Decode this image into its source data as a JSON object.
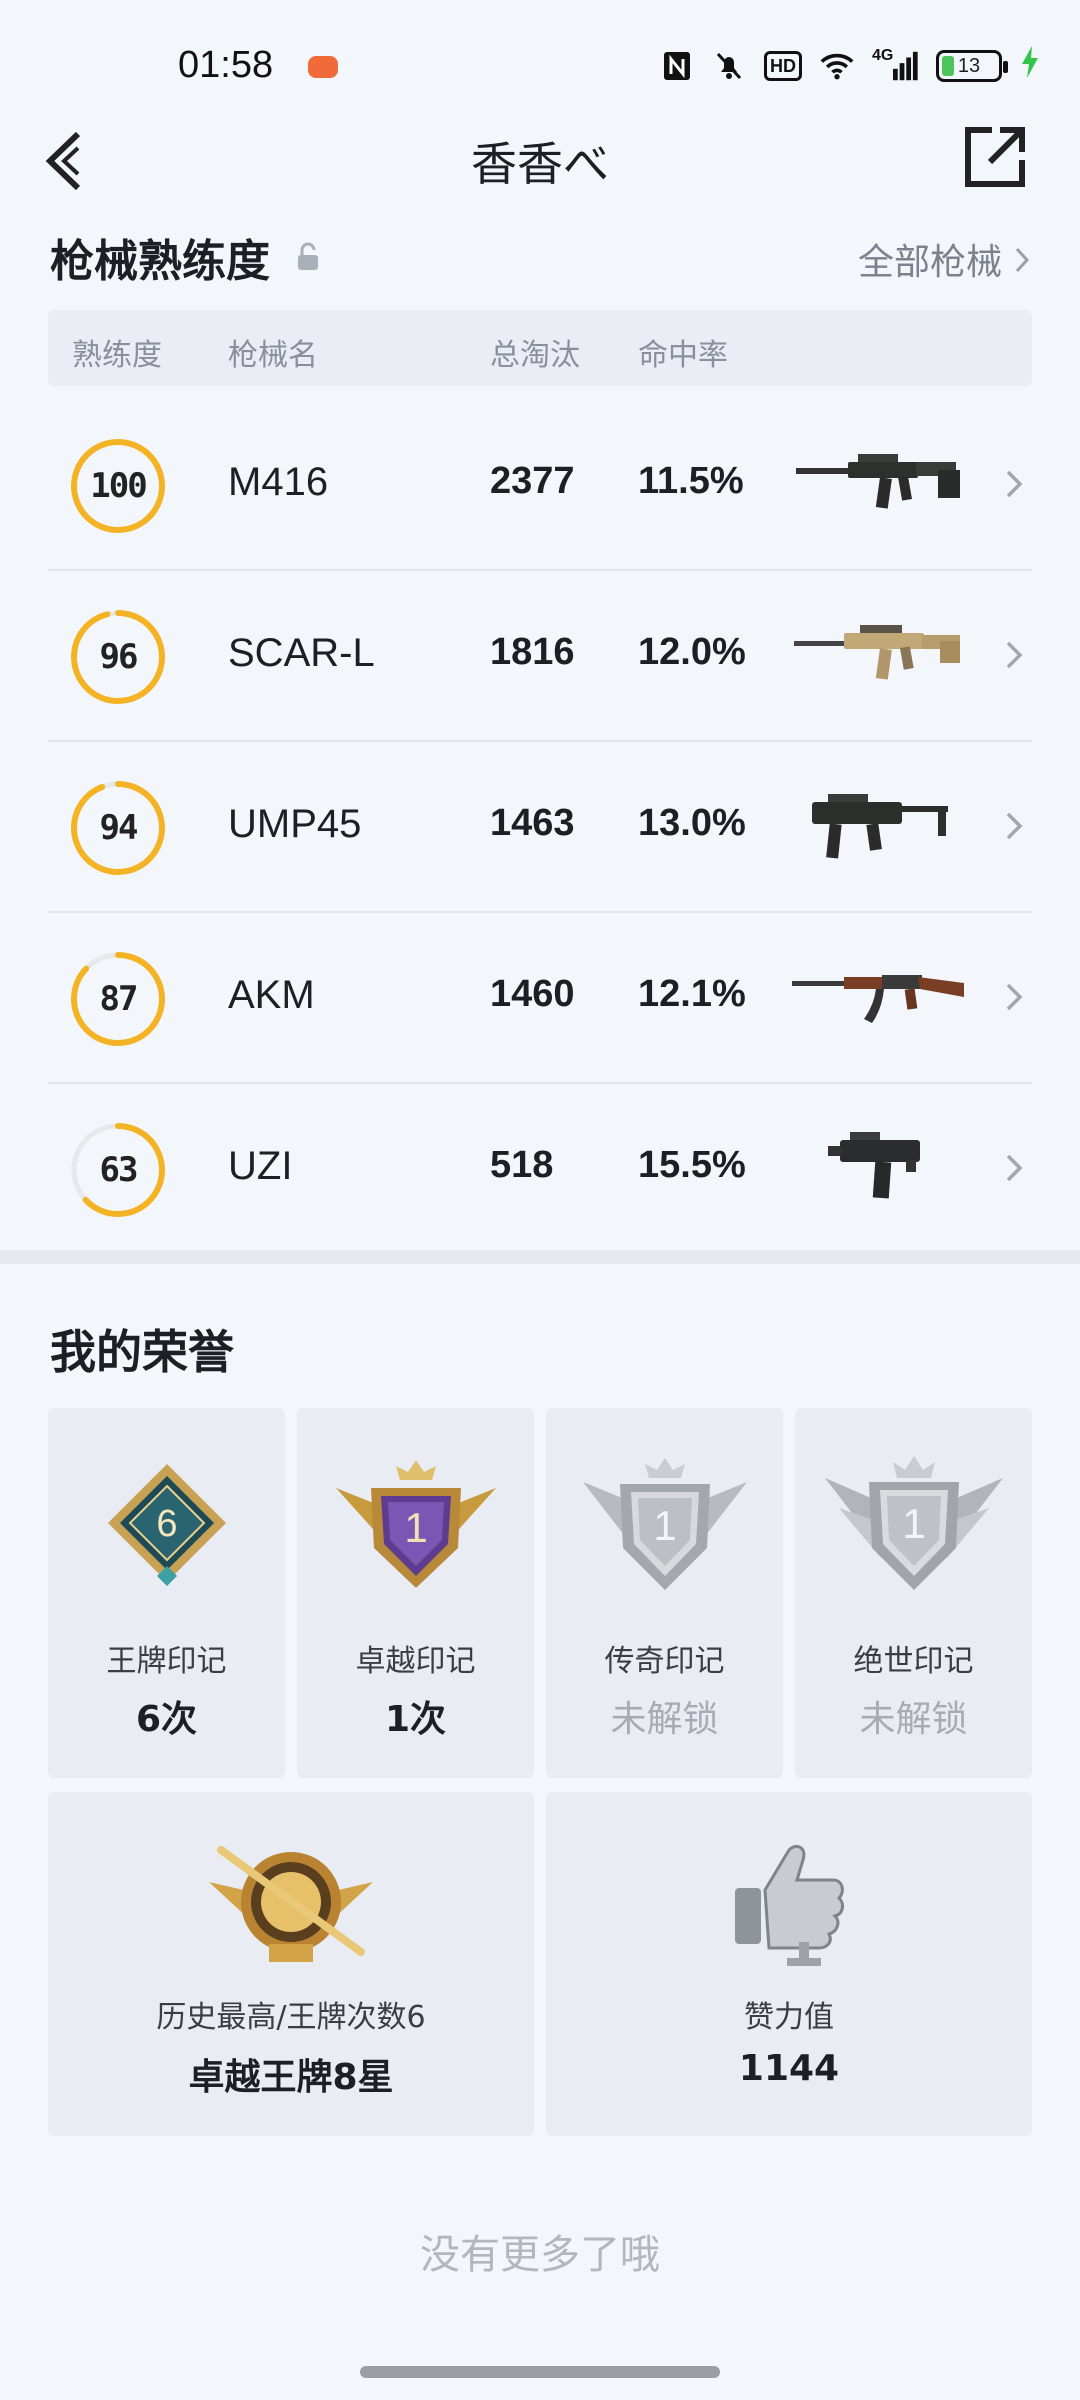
{
  "status_bar": {
    "time": "01:58",
    "network": "4G",
    "battery": "13"
  },
  "header": {
    "title": "香香べ"
  },
  "weapons": {
    "title": "枪械熟练度",
    "all_link": "全部枪械",
    "columns": {
      "proficiency": "熟练度",
      "name": "枪械名",
      "kills": "总淘汰",
      "hit_rate": "命中率"
    },
    "rows": [
      {
        "proficiency": "100",
        "name": "M416",
        "kills": "2377",
        "hit_rate": "11.5%",
        "icon": "m416-rifle-icon"
      },
      {
        "proficiency": "96",
        "name": "SCAR-L",
        "kills": "1816",
        "hit_rate": "12.0%",
        "icon": "scar-l-rifle-icon"
      },
      {
        "proficiency": "94",
        "name": "UMP45",
        "kills": "1463",
        "hit_rate": "13.0%",
        "icon": "ump45-smg-icon"
      },
      {
        "proficiency": "87",
        "name": "AKM",
        "kills": "1460",
        "hit_rate": "12.1%",
        "icon": "akm-rifle-icon"
      },
      {
        "proficiency": "63",
        "name": "UZI",
        "kills": "518",
        "hit_rate": "15.5%",
        "icon": "uzi-smg-icon"
      }
    ],
    "ring_color": "#f4b324"
  },
  "honors": {
    "title": "我的荣誉",
    "marks": [
      {
        "label": "王牌印记",
        "value": "6次",
        "locked": false,
        "badge_number": "6",
        "icon": "ace-mark-icon"
      },
      {
        "label": "卓越印记",
        "value": "1次",
        "locked": false,
        "badge_number": "1",
        "icon": "excellence-mark-icon"
      },
      {
        "label": "传奇印记",
        "value": "未解锁",
        "locked": true,
        "badge_number": "1",
        "icon": "legend-mark-icon"
      },
      {
        "label": "绝世印记",
        "value": "未解锁",
        "locked": true,
        "badge_number": "1",
        "icon": "peerless-mark-icon"
      }
    ],
    "history": {
      "label": "历史最高/王牌次数6",
      "value": "卓越王牌8星",
      "icon": "rank-emblem-icon"
    },
    "likes": {
      "label": "赞力值",
      "value": "1144",
      "icon": "thumbs-up-icon"
    }
  },
  "footer": {
    "text": "没有更多了哦"
  }
}
